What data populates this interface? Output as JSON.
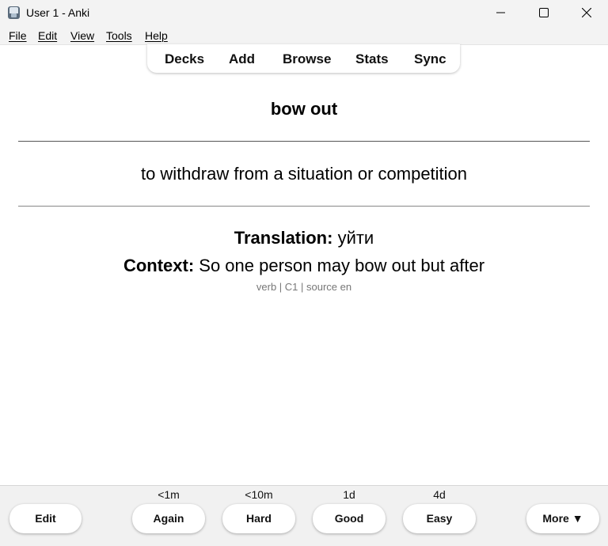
{
  "window": {
    "title": "User 1 - Anki"
  },
  "menu": {
    "items": [
      "File",
      "Edit",
      "View",
      "Tools",
      "Help"
    ]
  },
  "toolbar": {
    "items": [
      "Decks",
      "Add",
      "Browse",
      "Stats",
      "Sync"
    ]
  },
  "card": {
    "front": "bow out",
    "definition": "to withdraw from a situation or competition",
    "translation_label": "Translation:",
    "translation_value": " уйти",
    "context_label": "Context:",
    "context_value": " So one person may bow out but after",
    "meta": "verb | C1 | source en"
  },
  "bottom": {
    "edit_label": "Edit",
    "more_label": "More ▼",
    "answers": [
      {
        "label": "Again",
        "interval": "<1m"
      },
      {
        "label": "Hard",
        "interval": "<10m"
      },
      {
        "label": "Good",
        "interval": "1d"
      },
      {
        "label": "Easy",
        "interval": "4d"
      }
    ]
  },
  "icons": {
    "app": "anki-app-icon",
    "minimize": "minimize-icon",
    "maximize": "maximize-icon",
    "close": "close-icon"
  }
}
